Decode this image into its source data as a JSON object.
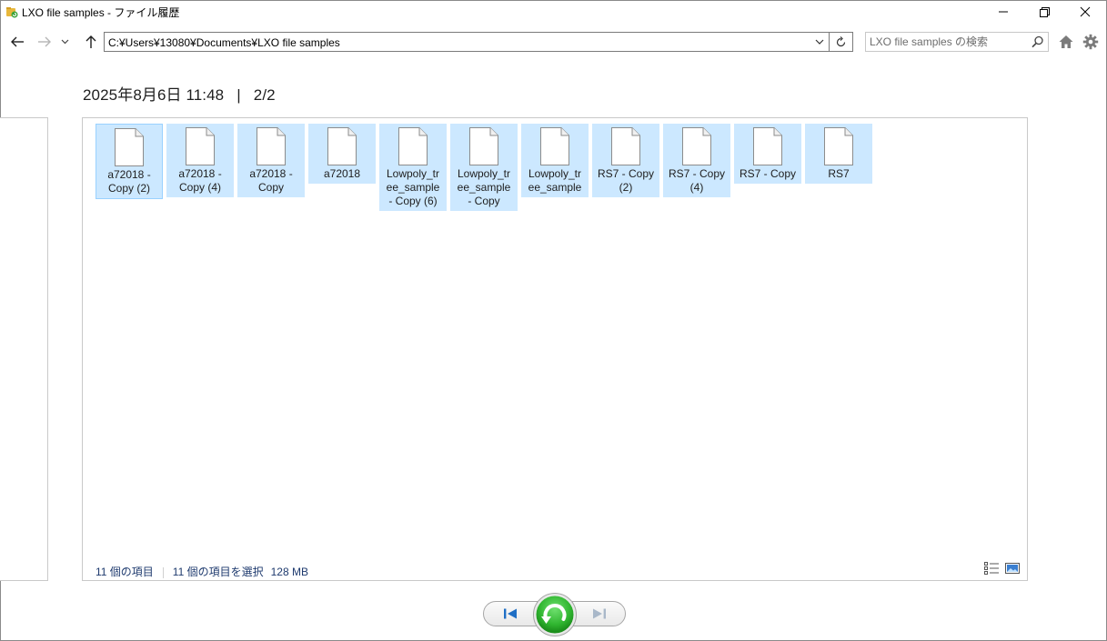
{
  "window": {
    "title": "LXO file samples - ファイル履歴",
    "controls": [
      "minimize",
      "restore",
      "close"
    ]
  },
  "navbar": {
    "address": "C:¥Users¥13080¥Documents¥LXO file samples",
    "search_placeholder": "LXO file samples の検索"
  },
  "header": {
    "date": "2025年8月6日 11:48",
    "separator": "|",
    "page": "2/2"
  },
  "files": [
    {
      "name": "a72018 - Copy (2)",
      "lines": [
        "a72018 -",
        "Copy (2)"
      ]
    },
    {
      "name": "a72018 - Copy (4)",
      "lines": [
        "a72018 -",
        "Copy (4)"
      ]
    },
    {
      "name": "a72018 - Copy",
      "lines": [
        "a72018 -",
        "Copy"
      ]
    },
    {
      "name": "a72018",
      "lines": [
        "a72018"
      ]
    },
    {
      "name": "Lowpoly_tree_sample - Copy (6)",
      "lines": [
        "Lowpoly_tr",
        "ee_sample",
        "- Copy (6)"
      ]
    },
    {
      "name": "Lowpoly_tree_sample - Copy",
      "lines": [
        "Lowpoly_tr",
        "ee_sample",
        "- Copy"
      ]
    },
    {
      "name": "Lowpoly_tree_sample",
      "lines": [
        "Lowpoly_tr",
        "ee_sample"
      ]
    },
    {
      "name": "RS7 - Copy (2)",
      "lines": [
        "RS7 - Copy",
        "(2)"
      ]
    },
    {
      "name": "RS7 - Copy (4)",
      "lines": [
        "RS7 - Copy",
        "(4)"
      ]
    },
    {
      "name": "RS7 - Copy",
      "lines": [
        "RS7 - Copy"
      ]
    },
    {
      "name": "RS7",
      "lines": [
        "RS7"
      ]
    }
  ],
  "status": {
    "item_count": "11 個の項目",
    "selected": "11 個の項目を選択",
    "size": "128 MB"
  },
  "colors": {
    "selection": "#cce8ff",
    "selection_border": "#99d1ff",
    "restore_green": "#2fb52f",
    "nav_blue": "#1f6fc5"
  }
}
